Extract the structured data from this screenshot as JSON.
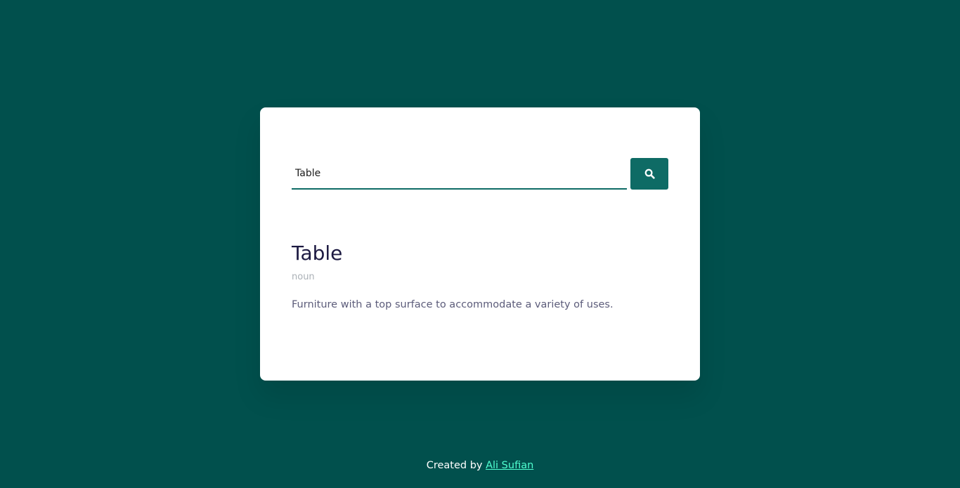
{
  "colors": {
    "page_background": "#01504d",
    "card_background": "#ffffff",
    "accent": "#0e6b65",
    "word_color": "#1d1a42",
    "link_color": "#4fffd0"
  },
  "search": {
    "value": "Table",
    "button_icon": "search-icon"
  },
  "result": {
    "word": "Table",
    "part_of_speech": "noun",
    "definition": "Furniture with a top surface to accommodate a variety of uses."
  },
  "footer": {
    "created_by_label": "Created by",
    "author_name": "Ali Sufian"
  }
}
